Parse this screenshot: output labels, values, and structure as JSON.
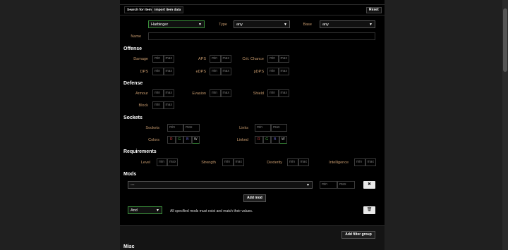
{
  "tabs": {
    "search": "Search for items",
    "import": "Import item data"
  },
  "reset_label": "Reset",
  "filters": {
    "league": {
      "label": "League",
      "value": "Harbinger"
    },
    "type": {
      "label": "Type",
      "value": "any"
    },
    "base": {
      "label": "Base",
      "value": "any"
    },
    "name": {
      "label": "Name",
      "value": ""
    }
  },
  "placeholders": {
    "min": "min",
    "max": "max"
  },
  "offense": {
    "title": "Offense",
    "damage": "Damage",
    "aps": "APS",
    "crit": "Crit. Chance",
    "dps": "DPS",
    "edps": "eDPS",
    "pdps": "pDPS"
  },
  "defense": {
    "title": "Defense",
    "armour": "Armour",
    "evasion": "Evasion",
    "shield": "Shield",
    "block": "Block"
  },
  "sockets": {
    "title": "Sockets",
    "sockets": "Sockets",
    "links": "Links",
    "colors": "Colors",
    "linked": "Linked",
    "rgbw": [
      "R",
      "G",
      "B",
      "W"
    ]
  },
  "requirements": {
    "title": "Requirements",
    "level": "Level",
    "strength": "Strength",
    "dexterity": "Dexterity",
    "intelligence": "Intelligence"
  },
  "mods": {
    "title": "Mods",
    "mod_select": "---",
    "add_mod": "Add mod",
    "group_type": "And",
    "hint": "All specified mods must exist and match their values.",
    "add_group": "Add filter group"
  },
  "misc": {
    "title": "Misc"
  },
  "icons": {
    "remove": "close-icon",
    "delete": "trash-icon",
    "dropdown": "chevron-down-icon"
  },
  "colors": {
    "label": "#c79a6d",
    "accent_green": "#3a8f3a",
    "panel": "#000000"
  }
}
